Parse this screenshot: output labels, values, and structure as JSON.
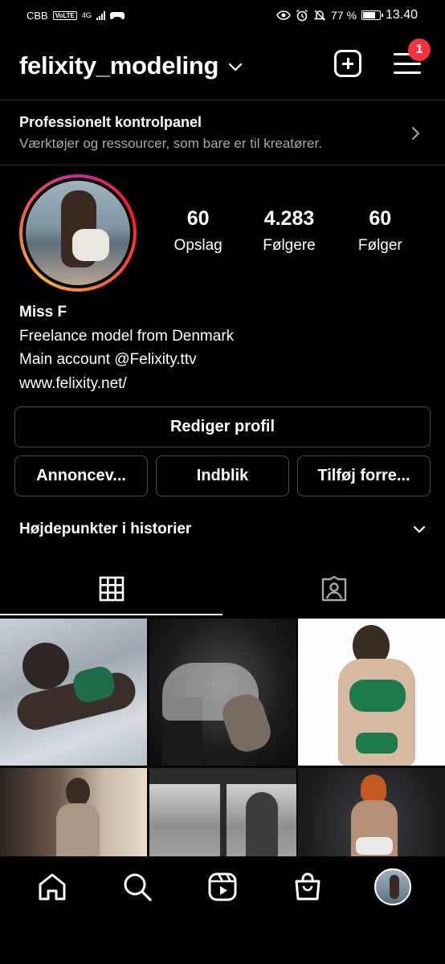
{
  "status_bar": {
    "carrier": "CBB",
    "volte": "VoLTE",
    "network": "4G",
    "battery_text": "77 %",
    "battery_level": 0.77,
    "time": "13.40"
  },
  "header": {
    "username": "felixity_modeling",
    "notification_count": "1"
  },
  "pro_dashboard": {
    "title": "Professionelt kontrolpanel",
    "subtitle": "Værktøjer og ressourcer, som bare er til kreatører."
  },
  "stats": [
    {
      "value": "60",
      "label": "Opslag"
    },
    {
      "value": "4.283",
      "label": "Følgere"
    },
    {
      "value": "60",
      "label": "Følger"
    }
  ],
  "bio": {
    "name": "Miss F",
    "line1": "Freelance model from Denmark",
    "line2": "Main account @Felixity.ttv",
    "link": "www.felixity.net/"
  },
  "buttons": {
    "edit_profile": "Rediger profil",
    "ads": "Annoncev...",
    "insights": "Indblik",
    "add_shop": "Tilføj forre..."
  },
  "highlights": {
    "title": "Højdepunkter i historier"
  },
  "tabs": [
    {
      "icon": "grid-icon",
      "active": true
    },
    {
      "icon": "tagged-icon",
      "active": false
    }
  ],
  "posts": [
    {
      "icon": "photo-1"
    },
    {
      "icon": "photo-2"
    },
    {
      "icon": "photo-3"
    },
    {
      "icon": "photo-4"
    },
    {
      "icon": "photo-5"
    },
    {
      "icon": "photo-6"
    }
  ],
  "bottom_nav": [
    {
      "icon": "home-icon"
    },
    {
      "icon": "search-icon"
    },
    {
      "icon": "reels-icon"
    },
    {
      "icon": "shop-icon"
    },
    {
      "icon": "profile-avatar"
    }
  ],
  "colors": {
    "background": "#000000",
    "badge": "#ff3040",
    "secondary_text": "#a8a8a8",
    "button_border": "#4a4a4a"
  }
}
